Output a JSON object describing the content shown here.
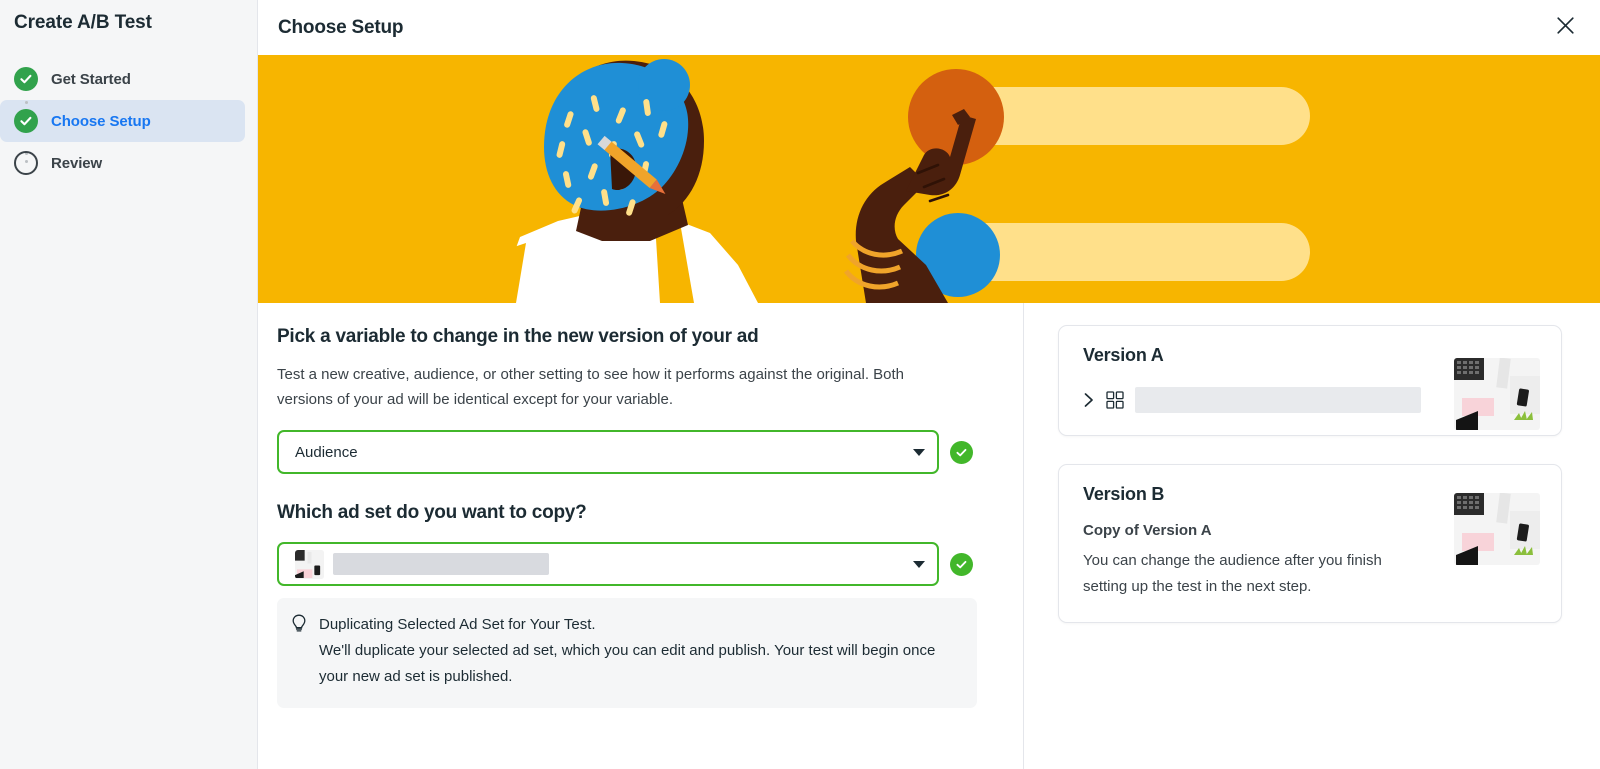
{
  "sidebar": {
    "title": "Create A/B Test",
    "steps": [
      {
        "label": "Get Started",
        "state": "done",
        "icon": "check-circle-icon"
      },
      {
        "label": "Choose Setup",
        "state": "active",
        "icon": "check-circle-icon"
      },
      {
        "label": "Review",
        "state": "todo",
        "icon": "empty-circle-icon"
      }
    ]
  },
  "topbar": {
    "title": "Choose Setup",
    "close_icon": "close-icon"
  },
  "hero": {
    "alt": "illustration-person-pointing-at-two-ad-variants",
    "bg_color": "#f7b500",
    "bar_color": "#ffe08a",
    "circle_orange": "#d4600f",
    "circle_blue": "#1f8fd6",
    "headwrap_color": "#1f8fd6",
    "skin_color": "#4a1f0d",
    "shirt_color": "#ffffff"
  },
  "variable_section": {
    "heading": "Pick a variable to change in the new version of your ad",
    "description": "Test a new creative, audience, or other setting to see how it performs against the original. Both versions of your ad will be identical except for your variable.",
    "select": {
      "value": "Audience",
      "caret_icon": "chevron-down-icon",
      "status_icon": "check-circle-icon",
      "border_color": "#42b72a"
    }
  },
  "adset_section": {
    "heading": "Which ad set do you want to copy?",
    "select": {
      "value": "",
      "thumbnail_icon": "ad-thumbnail-icon",
      "caret_icon": "chevron-down-icon",
      "status_icon": "check-circle-icon",
      "border_color": "#42b72a"
    },
    "tip": {
      "icon": "lightbulb-icon",
      "title": "Duplicating Selected Ad Set for Your Test.",
      "body": "We'll duplicate your selected ad set, which you can edit and publish. Your test will begin once your new ad set is published."
    }
  },
  "versions": {
    "version_a": {
      "title": "Version A",
      "expand_icon": "chevron-right-icon",
      "grid_icon": "grid-icon",
      "name": "",
      "thumbnail_icon": "ad-preview-thumbnail"
    },
    "version_b": {
      "title": "Version B",
      "subtitle": "Copy of Version A",
      "description": "You can change the audience after you finish setting up the test in the next step.",
      "thumbnail_icon": "ad-preview-thumbnail"
    }
  }
}
